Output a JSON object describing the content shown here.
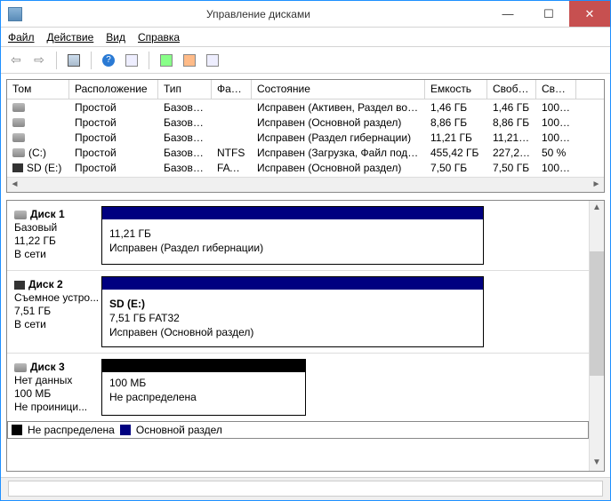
{
  "window": {
    "title": "Управление дисками"
  },
  "menu": {
    "file": "Файл",
    "action": "Действие",
    "view": "Вид",
    "help": "Справка"
  },
  "columns": {
    "tom": "Том",
    "ras": "Расположение",
    "tip": "Тип",
    "fai": "Фай...",
    "sos": "Состояние",
    "emk": "Емкость",
    "svb": "Свобод...",
    "svo": "Своб..."
  },
  "volumes": [
    {
      "tom": "",
      "ras": "Простой",
      "tip": "Базовый",
      "fai": "",
      "sos": "Исправен (Активен, Раздел восс...",
      "emk": "1,46 ГБ",
      "svb": "1,46 ГБ",
      "svo": "100 %",
      "icon": "disk"
    },
    {
      "tom": "",
      "ras": "Простой",
      "tip": "Базовый",
      "fai": "",
      "sos": "Исправен (Основной раздел)",
      "emk": "8,86 ГБ",
      "svb": "8,86 ГБ",
      "svo": "100 %",
      "icon": "disk"
    },
    {
      "tom": "",
      "ras": "Простой",
      "tip": "Базовый",
      "fai": "",
      "sos": "Исправен (Раздел гибернации)",
      "emk": "11,21 ГБ",
      "svb": "11,21 ГБ",
      "svo": "100 %",
      "icon": "disk"
    },
    {
      "tom": "(C:)",
      "ras": "Простой",
      "tip": "Базовый",
      "fai": "NTFS",
      "sos": "Исправен (Загрузка, Файл подка...",
      "emk": "455,42 ГБ",
      "svb": "227,24 ГБ",
      "svo": "50 %",
      "icon": "disk"
    },
    {
      "tom": "SD (E:)",
      "ras": "Простой",
      "tip": "Базовый",
      "fai": "FAT32",
      "sos": "Исправен (Основной раздел)",
      "emk": "7,50 ГБ",
      "svb": "7,50 ГБ",
      "svo": "100 %",
      "icon": "sd"
    }
  ],
  "disks": {
    "d1": {
      "name": "Диск 1",
      "l1": "Базовый",
      "l2": "11,22 ГБ",
      "l3": "В сети",
      "p1": "11,21 ГБ",
      "p2": "Исправен (Раздел гибернации)"
    },
    "d2": {
      "name": "Диск 2",
      "l1": "Съемное устро...",
      "l2": "7,51 ГБ",
      "l3": "В сети",
      "pt": "SD  (E:)",
      "p1": "7,51 ГБ FAT32",
      "p2": "Исправен (Основной раздел)"
    },
    "d3": {
      "name": "Диск 3",
      "l1": "Нет данных",
      "l2": "100 МБ",
      "l3": "Не проиници...",
      "p1": "100 МБ",
      "p2": "Не распределена"
    }
  },
  "legend": {
    "unalloc": "Не распределена",
    "primary": "Основной раздел"
  }
}
